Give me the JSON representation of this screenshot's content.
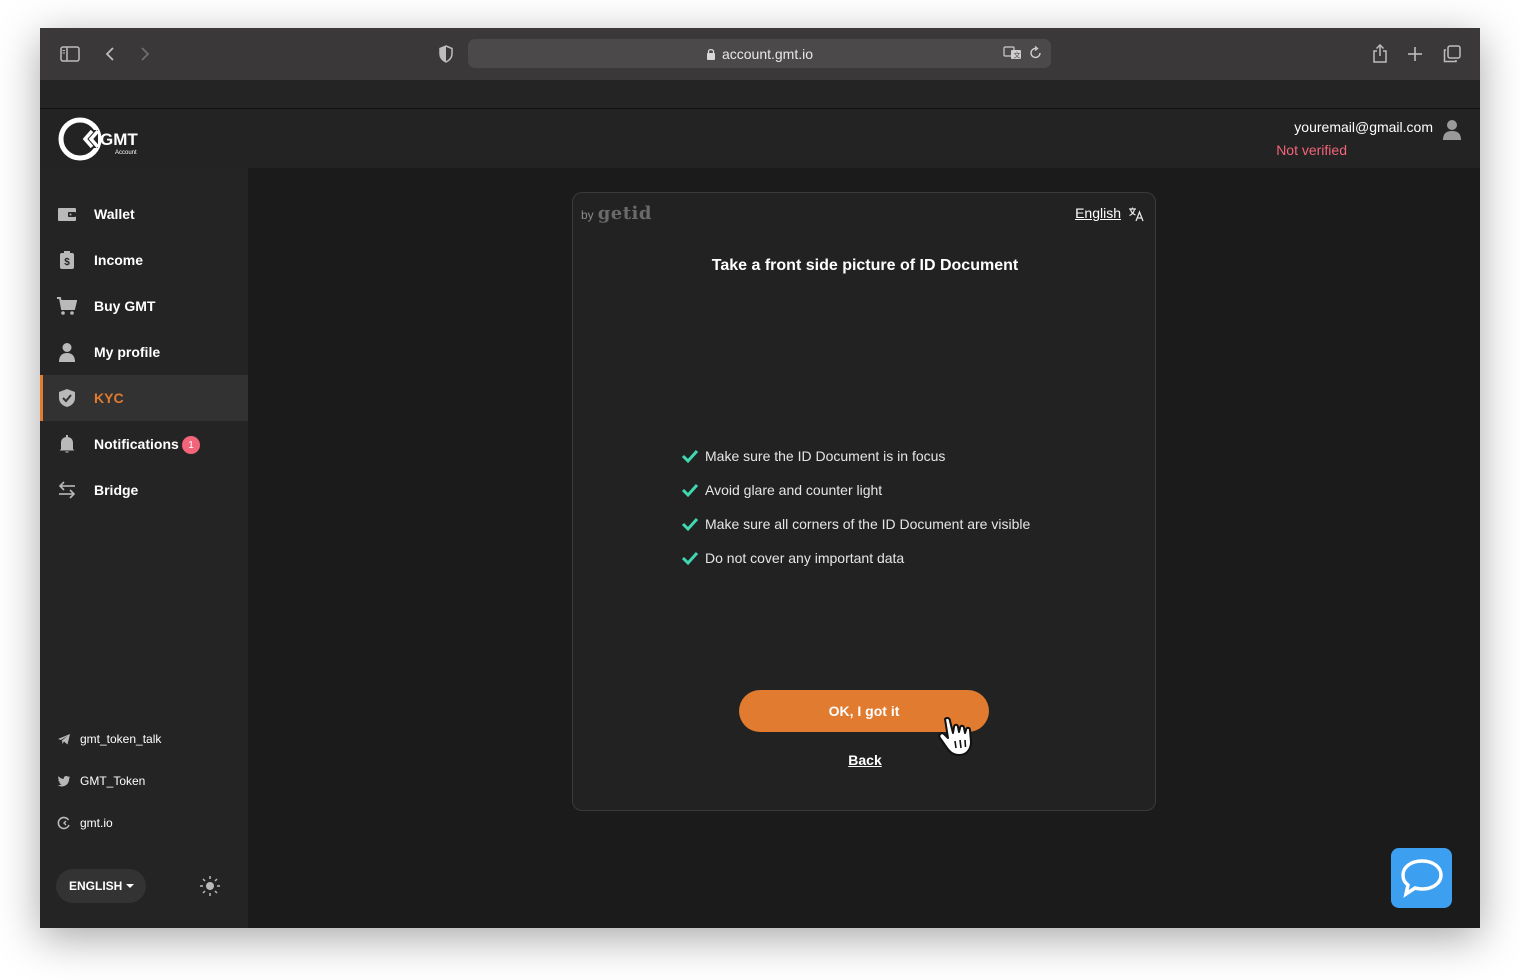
{
  "browser": {
    "url": "account.gmt.io"
  },
  "header": {
    "logo_text": "GMT",
    "logo_subtext": "Account",
    "user_email": "youremail@gmail.com",
    "user_status": "Not verified"
  },
  "sidebar": {
    "items": [
      {
        "label": "Wallet",
        "icon": "wallet-icon"
      },
      {
        "label": "Income",
        "icon": "income-icon"
      },
      {
        "label": "Buy GMT",
        "icon": "cart-icon"
      },
      {
        "label": "My profile",
        "icon": "user-icon"
      },
      {
        "label": "KYC",
        "icon": "shield-icon",
        "active": true
      },
      {
        "label": "Notifications",
        "icon": "bell-icon",
        "badge": "1"
      },
      {
        "label": "Bridge",
        "icon": "bridge-icon"
      }
    ],
    "social": [
      {
        "label": "gmt_token_talk",
        "icon": "telegram-icon"
      },
      {
        "label": "GMT_Token",
        "icon": "twitter-icon"
      },
      {
        "label": "gmt.io",
        "icon": "gmt-icon"
      }
    ],
    "language": "ENGLISH"
  },
  "card": {
    "by": "by",
    "brand": "getid",
    "language": "English",
    "title": "Take a front side picture of ID Document",
    "checks": [
      "Make sure the ID Document is in focus",
      "Avoid glare and counter light",
      "Make sure all corners of the ID Document are visible",
      "Do not cover any important data"
    ],
    "ok_label": "OK, I got it",
    "back_label": "Back"
  },
  "colors": {
    "accent": "#e07b30",
    "check": "#3fd8b0",
    "warning": "#f2647a",
    "chat": "#3c9ff0"
  }
}
